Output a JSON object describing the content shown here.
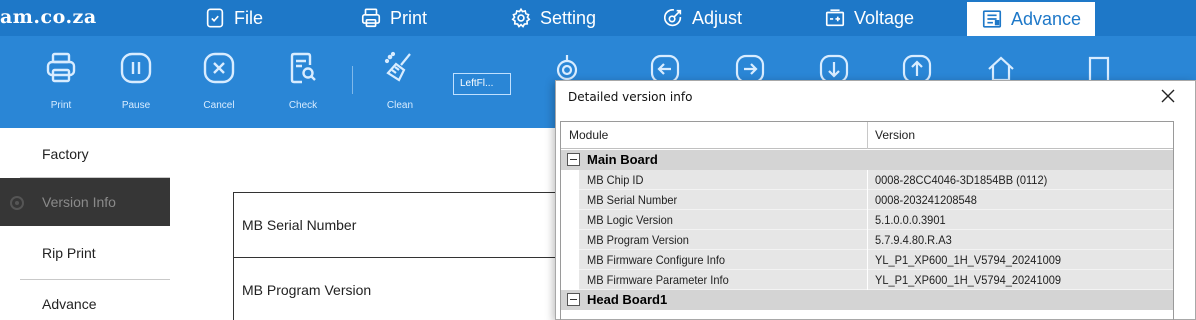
{
  "brand": {
    "text": "am.co.za"
  },
  "menu": {
    "tabs": [
      {
        "label": "File",
        "icon": "file-icon"
      },
      {
        "label": "Print",
        "icon": "printer-icon"
      },
      {
        "label": "Setting",
        "icon": "gear-icon"
      },
      {
        "label": "Adjust",
        "icon": "adjust-icon"
      },
      {
        "label": "Voltage",
        "icon": "voltage-icon"
      },
      {
        "label": "Advance",
        "icon": "advance-icon",
        "active": true
      }
    ]
  },
  "toolbar": {
    "print_label": "Print",
    "pause_label": "Pause",
    "cancel_label": "Cancel",
    "check_label": "Check",
    "clean_label": "Clean",
    "position_field_value": "LeftFl..."
  },
  "sidenav": {
    "items": [
      {
        "label": "Factory"
      },
      {
        "label": "Version Info",
        "active": true
      },
      {
        "label": "Rip Print"
      },
      {
        "label": "Advance"
      }
    ]
  },
  "properties": {
    "rows": [
      {
        "label": "MB Serial Number"
      },
      {
        "label": "MB Program Version"
      }
    ]
  },
  "dialog": {
    "title": "Detailed version info",
    "columns": {
      "module": "Module",
      "version": "Version"
    },
    "groups": [
      {
        "name": "Main Board",
        "rows": [
          {
            "module": "MB Chip ID",
            "version": "0008-28CC4046-3D1854BB (0112)"
          },
          {
            "module": "MB Serial Number",
            "version": "0008-203241208548"
          },
          {
            "module": "MB Logic Version",
            "version": "5.1.0.0.0.3901"
          },
          {
            "module": "MB Program Version",
            "version": "5.7.9.4.80.R.A3"
          },
          {
            "module": "MB Firmware Configure Info",
            "version": "YL_P1_XP600_1H_V5794_20241009"
          },
          {
            "module": "MB Firmware Parameter Info",
            "version": "YL_P1_XP600_1H_V5794_20241009"
          }
        ]
      },
      {
        "name": "Head Board1",
        "rows": []
      }
    ]
  },
  "colors": {
    "menubar": "#1e78c8",
    "toolbar": "#2a86d6",
    "nav_active": "#363636",
    "group_header": "#d4d4d4",
    "row_bg": "#e6e6e6"
  }
}
